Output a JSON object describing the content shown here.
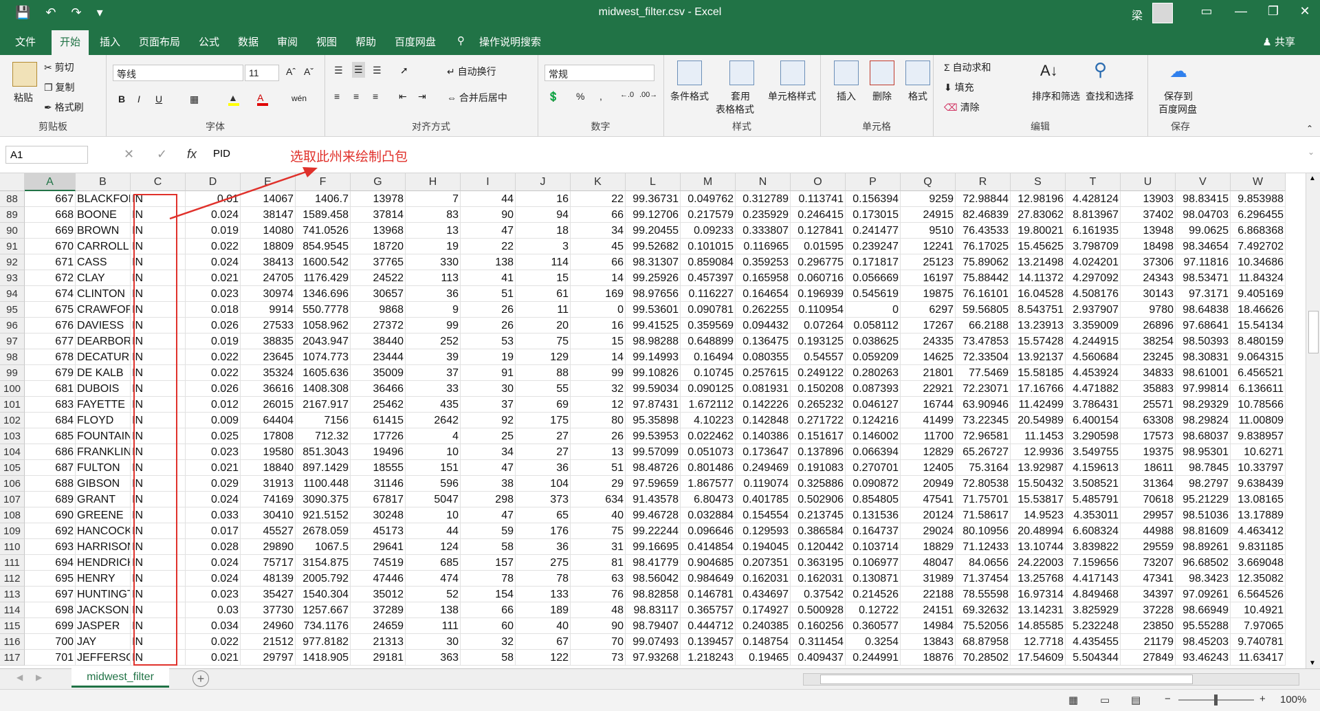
{
  "window": {
    "title": "midwest_filter.csv  -  Excel",
    "user": "梁",
    "ribbon_display_icon": "ribbon-display-icon",
    "minimize_icon": "minimize-icon",
    "restore_icon": "restore-icon",
    "close_icon": "close-icon"
  },
  "quick_access": {
    "save_icon": "save-icon",
    "undo_icon": "undo-icon",
    "redo_icon": "redo-icon",
    "customize_icon": "customize-icon"
  },
  "menu": {
    "tabs": [
      "文件",
      "开始",
      "插入",
      "页面布局",
      "公式",
      "数据",
      "审阅",
      "视图",
      "帮助",
      "百度网盘"
    ],
    "active": "开始",
    "tell_me": "操作说明搜索",
    "share": "共享"
  },
  "ribbon": {
    "clipboard": {
      "label": "剪贴板",
      "paste": "粘贴",
      "cut": "剪切",
      "copy": "复制",
      "format_painter": "格式刷"
    },
    "font": {
      "label": "字体",
      "font_name": "等线",
      "font_size": "11",
      "bold": "B",
      "italic": "I",
      "underline": "U",
      "phonetic": "wén"
    },
    "alignment": {
      "label": "对齐方式",
      "wrap": "自动换行",
      "merge": "合并后居中"
    },
    "number": {
      "label": "数字",
      "format": "常规",
      "percent": "%",
      "comma": ","
    },
    "styles": {
      "label": "样式",
      "conditional": "条件格式",
      "table_1": "套用",
      "table_2": "表格格式",
      "cell_styles": "单元格样式"
    },
    "cells": {
      "label": "单元格",
      "insert": "插入",
      "delete": "删除",
      "format": "格式"
    },
    "editing": {
      "label": "编辑",
      "autosum": "自动求和",
      "fill": "填充",
      "clear": "清除",
      "sort": "排序和筛选",
      "find": "查找和选择"
    },
    "save": {
      "label": "保存",
      "save_1": "保存到",
      "save_2": "百度网盘"
    }
  },
  "formula_bar": {
    "name_box": "A1",
    "fx": "fx",
    "content": "PID",
    "annotation": "选取此州来绘制凸包"
  },
  "grid": {
    "columns": [
      "A",
      "B",
      "C",
      "D",
      "E",
      "F",
      "G",
      "H",
      "I",
      "J",
      "K",
      "L",
      "M",
      "N",
      "O",
      "P",
      "Q",
      "R",
      "S",
      "T",
      "U",
      "V",
      "W"
    ],
    "rows": [
      [
        "88",
        "667",
        "BLACKFORD",
        "IN",
        "0.01",
        "14067",
        "1406.7",
        "13978",
        "7",
        "44",
        "16",
        "22",
        "99.36731",
        "0.049762",
        "0.312789",
        "0.113741",
        "0.156394",
        "9259",
        "72.98844",
        "12.98196",
        "4.428124",
        "13903",
        "98.83415",
        "9.853988"
      ],
      [
        "89",
        "668",
        "BOONE",
        "IN",
        "0.024",
        "38147",
        "1589.458",
        "37814",
        "83",
        "90",
        "94",
        "66",
        "99.12706",
        "0.217579",
        "0.235929",
        "0.246415",
        "0.173015",
        "24915",
        "82.46839",
        "27.83062",
        "8.813967",
        "37402",
        "98.04703",
        "6.296455"
      ],
      [
        "90",
        "669",
        "BROWN",
        "IN",
        "0.019",
        "14080",
        "741.0526",
        "13968",
        "13",
        "47",
        "18",
        "34",
        "99.20455",
        "0.09233",
        "0.333807",
        "0.127841",
        "0.241477",
        "9510",
        "76.43533",
        "19.80021",
        "6.161935",
        "13948",
        "99.0625",
        "6.868368"
      ],
      [
        "91",
        "670",
        "CARROLL",
        "IN",
        "0.022",
        "18809",
        "854.9545",
        "18720",
        "19",
        "22",
        "3",
        "45",
        "99.52682",
        "0.101015",
        "0.116965",
        "0.01595",
        "0.239247",
        "12241",
        "76.17025",
        "15.45625",
        "3.798709",
        "18498",
        "98.34654",
        "7.492702"
      ],
      [
        "92",
        "671",
        "CASS",
        "IN",
        "0.024",
        "38413",
        "1600.542",
        "37765",
        "330",
        "138",
        "114",
        "66",
        "98.31307",
        "0.859084",
        "0.359253",
        "0.296775",
        "0.171817",
        "25123",
        "75.89062",
        "13.21498",
        "4.024201",
        "37306",
        "97.11816",
        "10.34686"
      ],
      [
        "93",
        "672",
        "CLAY",
        "IN",
        "0.021",
        "24705",
        "1176.429",
        "24522",
        "113",
        "41",
        "15",
        "14",
        "99.25926",
        "0.457397",
        "0.165958",
        "0.060716",
        "0.056669",
        "16197",
        "75.88442",
        "14.11372",
        "4.297092",
        "24343",
        "98.53471",
        "11.84324"
      ],
      [
        "94",
        "674",
        "CLINTON",
        "IN",
        "0.023",
        "30974",
        "1346.696",
        "30657",
        "36",
        "51",
        "61",
        "169",
        "98.97656",
        "0.116227",
        "0.164654",
        "0.196939",
        "0.545619",
        "19875",
        "76.16101",
        "16.04528",
        "4.508176",
        "30143",
        "97.3171",
        "9.405169"
      ],
      [
        "95",
        "675",
        "CRAWFORD",
        "IN",
        "0.018",
        "9914",
        "550.7778",
        "9868",
        "9",
        "26",
        "11",
        "0",
        "99.53601",
        "0.090781",
        "0.262255",
        "0.110954",
        "0",
        "6297",
        "59.56805",
        "8.543751",
        "2.937907",
        "9780",
        "98.64838",
        "18.46626"
      ],
      [
        "96",
        "676",
        "DAVIESS",
        "IN",
        "0.026",
        "27533",
        "1058.962",
        "27372",
        "99",
        "26",
        "20",
        "16",
        "99.41525",
        "0.359569",
        "0.094432",
        "0.07264",
        "0.058112",
        "17267",
        "66.2188",
        "13.23913",
        "3.359009",
        "26896",
        "97.68641",
        "15.54134"
      ],
      [
        "97",
        "677",
        "DEARBORN",
        "IN",
        "0.019",
        "38835",
        "2043.947",
        "38440",
        "252",
        "53",
        "75",
        "15",
        "98.98288",
        "0.648899",
        "0.136475",
        "0.193125",
        "0.038625",
        "24335",
        "73.47853",
        "15.57428",
        "4.244915",
        "38254",
        "98.50393",
        "8.480159"
      ],
      [
        "98",
        "678",
        "DECATUR",
        "IN",
        "0.022",
        "23645",
        "1074.773",
        "23444",
        "39",
        "19",
        "129",
        "14",
        "99.14993",
        "0.16494",
        "0.080355",
        "0.54557",
        "0.059209",
        "14625",
        "72.33504",
        "13.92137",
        "4.560684",
        "23245",
        "98.30831",
        "9.064315"
      ],
      [
        "99",
        "679",
        "DE KALB",
        "IN",
        "0.022",
        "35324",
        "1605.636",
        "35009",
        "37",
        "91",
        "88",
        "99",
        "99.10826",
        "0.10745",
        "0.257615",
        "0.249122",
        "0.280263",
        "21801",
        "77.5469",
        "15.58185",
        "4.453924",
        "34833",
        "98.61001",
        "6.456521"
      ],
      [
        "100",
        "681",
        "DUBOIS",
        "IN",
        "0.026",
        "36616",
        "1408.308",
        "36466",
        "33",
        "30",
        "55",
        "32",
        "99.59034",
        "0.090125",
        "0.081931",
        "0.150208",
        "0.087393",
        "22921",
        "72.23071",
        "17.16766",
        "4.471882",
        "35883",
        "97.99814",
        "6.136611"
      ],
      [
        "101",
        "683",
        "FAYETTE",
        "IN",
        "0.012",
        "26015",
        "2167.917",
        "25462",
        "435",
        "37",
        "69",
        "12",
        "97.87431",
        "1.672112",
        "0.142226",
        "0.265232",
        "0.046127",
        "16744",
        "63.90946",
        "11.42499",
        "3.786431",
        "25571",
        "98.29329",
        "10.78566"
      ],
      [
        "102",
        "684",
        "FLOYD",
        "IN",
        "0.009",
        "64404",
        "7156",
        "61415",
        "2642",
        "92",
        "175",
        "80",
        "95.35898",
        "4.10223",
        "0.142848",
        "0.271722",
        "0.124216",
        "41499",
        "73.22345",
        "20.54989",
        "6.400154",
        "63308",
        "98.29824",
        "11.00809"
      ],
      [
        "103",
        "685",
        "FOUNTAIN",
        "IN",
        "0.025",
        "17808",
        "712.32",
        "17726",
        "4",
        "25",
        "27",
        "26",
        "99.53953",
        "0.022462",
        "0.140386",
        "0.151617",
        "0.146002",
        "11700",
        "72.96581",
        "11.1453",
        "3.290598",
        "17573",
        "98.68037",
        "9.838957"
      ],
      [
        "104",
        "686",
        "FRANKLIN",
        "IN",
        "0.023",
        "19580",
        "851.3043",
        "19496",
        "10",
        "34",
        "27",
        "13",
        "99.57099",
        "0.051073",
        "0.173647",
        "0.137896",
        "0.066394",
        "12829",
        "65.26727",
        "12.9936",
        "3.549755",
        "19375",
        "98.95301",
        "10.6271"
      ],
      [
        "105",
        "687",
        "FULTON",
        "IN",
        "0.021",
        "18840",
        "897.1429",
        "18555",
        "151",
        "47",
        "36",
        "51",
        "98.48726",
        "0.801486",
        "0.249469",
        "0.191083",
        "0.270701",
        "12405",
        "75.3164",
        "13.92987",
        "4.159613",
        "18611",
        "98.7845",
        "10.33797"
      ],
      [
        "106",
        "688",
        "GIBSON",
        "IN",
        "0.029",
        "31913",
        "1100.448",
        "31146",
        "596",
        "38",
        "104",
        "29",
        "97.59659",
        "1.867577",
        "0.119074",
        "0.325886",
        "0.090872",
        "20949",
        "72.80538",
        "15.50432",
        "3.508521",
        "31364",
        "98.2797",
        "9.638439"
      ],
      [
        "107",
        "689",
        "GRANT",
        "IN",
        "0.024",
        "74169",
        "3090.375",
        "67817",
        "5047",
        "298",
        "373",
        "634",
        "91.43578",
        "6.80473",
        "0.401785",
        "0.502906",
        "0.854805",
        "47541",
        "71.75701",
        "15.53817",
        "5.485791",
        "70618",
        "95.21229",
        "13.08165"
      ],
      [
        "108",
        "690",
        "GREENE",
        "IN",
        "0.033",
        "30410",
        "921.5152",
        "30248",
        "10",
        "47",
        "65",
        "40",
        "99.46728",
        "0.032884",
        "0.154554",
        "0.213745",
        "0.131536",
        "20124",
        "71.58617",
        "14.9523",
        "4.353011",
        "29957",
        "98.51036",
        "13.17889"
      ],
      [
        "109",
        "692",
        "HANCOCK",
        "IN",
        "0.017",
        "45527",
        "2678.059",
        "45173",
        "44",
        "59",
        "176",
        "75",
        "99.22244",
        "0.096646",
        "0.129593",
        "0.386584",
        "0.164737",
        "29024",
        "80.10956",
        "20.48994",
        "6.608324",
        "44988",
        "98.81609",
        "4.463412"
      ],
      [
        "110",
        "693",
        "HARRISON",
        "IN",
        "0.028",
        "29890",
        "1067.5",
        "29641",
        "124",
        "58",
        "36",
        "31",
        "99.16695",
        "0.414854",
        "0.194045",
        "0.120442",
        "0.103714",
        "18829",
        "71.12433",
        "13.10744",
        "3.839822",
        "29559",
        "98.89261",
        "9.831185"
      ],
      [
        "111",
        "694",
        "HENDRICKS",
        "IN",
        "0.024",
        "75717",
        "3154.875",
        "74519",
        "685",
        "157",
        "275",
        "81",
        "98.41779",
        "0.904685",
        "0.207351",
        "0.363195",
        "0.106977",
        "48047",
        "84.0656",
        "24.22003",
        "7.159656",
        "73207",
        "96.68502",
        "3.669048"
      ],
      [
        "112",
        "695",
        "HENRY",
        "IN",
        "0.024",
        "48139",
        "2005.792",
        "47446",
        "474",
        "78",
        "78",
        "63",
        "98.56042",
        "0.984649",
        "0.162031",
        "0.162031",
        "0.130871",
        "31989",
        "71.37454",
        "13.25768",
        "4.417143",
        "47341",
        "98.3423",
        "12.35082"
      ],
      [
        "113",
        "697",
        "HUNTINGTON",
        "IN",
        "0.023",
        "35427",
        "1540.304",
        "35012",
        "52",
        "154",
        "133",
        "76",
        "98.82858",
        "0.146781",
        "0.434697",
        "0.37542",
        "0.214526",
        "22188",
        "78.55598",
        "16.97314",
        "4.849468",
        "34397",
        "97.09261",
        "6.564526"
      ],
      [
        "114",
        "698",
        "JACKSON",
        "IN",
        "0.03",
        "37730",
        "1257.667",
        "37289",
        "138",
        "66",
        "189",
        "48",
        "98.83117",
        "0.365757",
        "0.174927",
        "0.500928",
        "0.12722",
        "24151",
        "69.32632",
        "13.14231",
        "3.825929",
        "37228",
        "98.66949",
        "10.4921"
      ],
      [
        "115",
        "699",
        "JASPER",
        "IN",
        "0.034",
        "24960",
        "734.1176",
        "24659",
        "111",
        "60",
        "40",
        "90",
        "98.79407",
        "0.444712",
        "0.240385",
        "0.160256",
        "0.360577",
        "14984",
        "75.52056",
        "14.85585",
        "5.232248",
        "23850",
        "95.55288",
        "7.97065"
      ],
      [
        "116",
        "700",
        "JAY",
        "IN",
        "0.022",
        "21512",
        "977.8182",
        "21313",
        "30",
        "32",
        "67",
        "70",
        "99.07493",
        "0.139457",
        "0.148754",
        "0.311454",
        "0.3254",
        "13843",
        "68.87958",
        "12.7718",
        "4.435455",
        "21179",
        "98.45203",
        "9.740781"
      ],
      [
        "117",
        "701",
        "JEFFERSON",
        "IN",
        "0.021",
        "29797",
        "1418.905",
        "29181",
        "363",
        "58",
        "122",
        "73",
        "97.93268",
        "1.218243",
        "0.19465",
        "0.409437",
        "0.244991",
        "18876",
        "70.28502",
        "17.54609",
        "5.504344",
        "27849",
        "93.46243",
        "11.63417"
      ]
    ]
  },
  "sheets": {
    "active": "midwest_filter",
    "add_icon": "plus-icon"
  },
  "status": {
    "zoom": "100%",
    "zoom_minus": "−",
    "zoom_plus": "+"
  }
}
